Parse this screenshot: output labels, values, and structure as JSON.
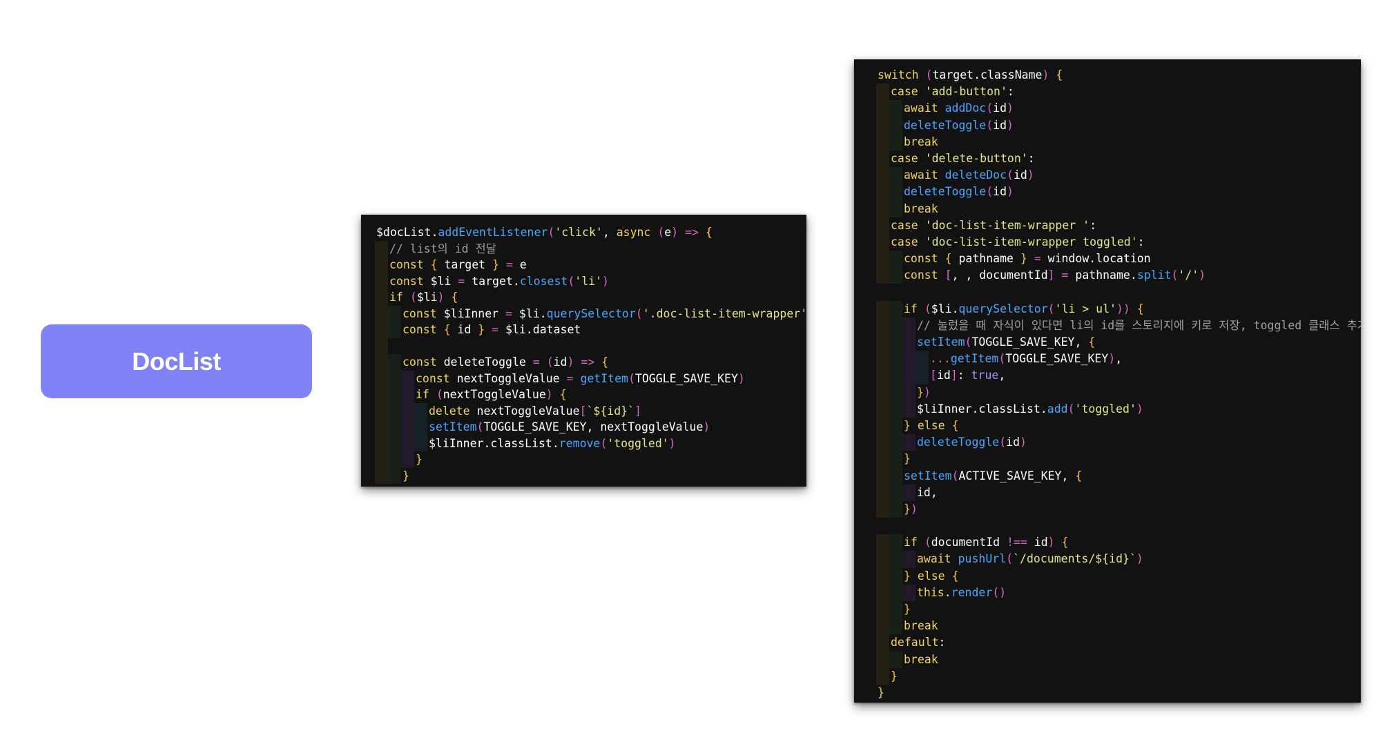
{
  "doclist_button": {
    "label": "DocList",
    "color": "#7f83f5"
  },
  "panel_a": {
    "lines": [
      {
        "indent": 0,
        "text": "$docList.addEventListener('click', async (e) => {"
      },
      {
        "indent": 1,
        "text": "// list의 id 전달"
      },
      {
        "indent": 1,
        "text": "const { target } = e"
      },
      {
        "indent": 1,
        "text": "const $li = target.closest('li')"
      },
      {
        "indent": 1,
        "text": "if ($li) {"
      },
      {
        "indent": 2,
        "text": "const $liInner = $li.querySelector('.doc-list-item-wrapper')"
      },
      {
        "indent": 2,
        "text": "const { id } = $li.dataset"
      },
      {
        "indent": 1,
        "text": ""
      },
      {
        "indent": 2,
        "text": "const deleteToggle = (id) => {"
      },
      {
        "indent": 3,
        "text": "const nextToggleValue = getItem(TOGGLE_SAVE_KEY)"
      },
      {
        "indent": 3,
        "text": "if (nextToggleValue) {"
      },
      {
        "indent": 4,
        "text": "delete nextToggleValue[`${id}`]"
      },
      {
        "indent": 4,
        "text": "setItem(TOGGLE_SAVE_KEY, nextToggleValue)"
      },
      {
        "indent": 4,
        "text": "$liInner.classList.remove('toggled')"
      },
      {
        "indent": 3,
        "text": "}"
      },
      {
        "indent": 2,
        "text": "}"
      }
    ]
  },
  "panel_b": {
    "lines": [
      {
        "indent": 0,
        "text": "switch (target.className) {"
      },
      {
        "indent": 1,
        "text": "case 'add-button':"
      },
      {
        "indent": 2,
        "text": "await addDoc(id)"
      },
      {
        "indent": 2,
        "text": "deleteToggle(id)"
      },
      {
        "indent": 2,
        "text": "break"
      },
      {
        "indent": 1,
        "text": "case 'delete-button':"
      },
      {
        "indent": 2,
        "text": "await deleteDoc(id)"
      },
      {
        "indent": 2,
        "text": "deleteToggle(id)"
      },
      {
        "indent": 2,
        "text": "break"
      },
      {
        "indent": 1,
        "text": "case 'doc-list-item-wrapper ':"
      },
      {
        "indent": 1,
        "text": "case 'doc-list-item-wrapper toggled':"
      },
      {
        "indent": 2,
        "text": "const { pathname } = window.location"
      },
      {
        "indent": 2,
        "text": "const [, , documentId] = pathname.split('/')"
      },
      {
        "indent": 0,
        "text": ""
      },
      {
        "indent": 2,
        "text": "if ($li.querySelector('li > ul')) {"
      },
      {
        "indent": 3,
        "text": "// 눌렀을 때 자식이 있다면 li의 id를 스토리지에 키로 저장, toggled 클래스 추가"
      },
      {
        "indent": 3,
        "text": "setItem(TOGGLE_SAVE_KEY, {"
      },
      {
        "indent": 4,
        "text": "...getItem(TOGGLE_SAVE_KEY),"
      },
      {
        "indent": 4,
        "text": "[id]: true,"
      },
      {
        "indent": 3,
        "text": "})"
      },
      {
        "indent": 3,
        "text": "$liInner.classList.add('toggled')"
      },
      {
        "indent": 2,
        "text": "} else {"
      },
      {
        "indent": 3,
        "text": "deleteToggle(id)"
      },
      {
        "indent": 2,
        "text": "}"
      },
      {
        "indent": 2,
        "text": "setItem(ACTIVE_SAVE_KEY, {"
      },
      {
        "indent": 3,
        "text": "id,"
      },
      {
        "indent": 2,
        "text": "})"
      },
      {
        "indent": 0,
        "text": ""
      },
      {
        "indent": 2,
        "text": "if (documentId !== id) {"
      },
      {
        "indent": 3,
        "text": "await pushUrl(`/documents/${id}`)"
      },
      {
        "indent": 2,
        "text": "} else {"
      },
      {
        "indent": 3,
        "text": "this.render()"
      },
      {
        "indent": 2,
        "text": "}"
      },
      {
        "indent": 2,
        "text": "break"
      },
      {
        "indent": 1,
        "text": "default:"
      },
      {
        "indent": 2,
        "text": "break"
      },
      {
        "indent": 1,
        "text": "}"
      },
      {
        "indent": 0,
        "text": "}"
      }
    ]
  },
  "colors": {
    "keyword": "#f4d35e",
    "function": "#4aa7ff",
    "string": "#e6e58a",
    "comment": "#9aa0a6",
    "background": "#121212"
  }
}
